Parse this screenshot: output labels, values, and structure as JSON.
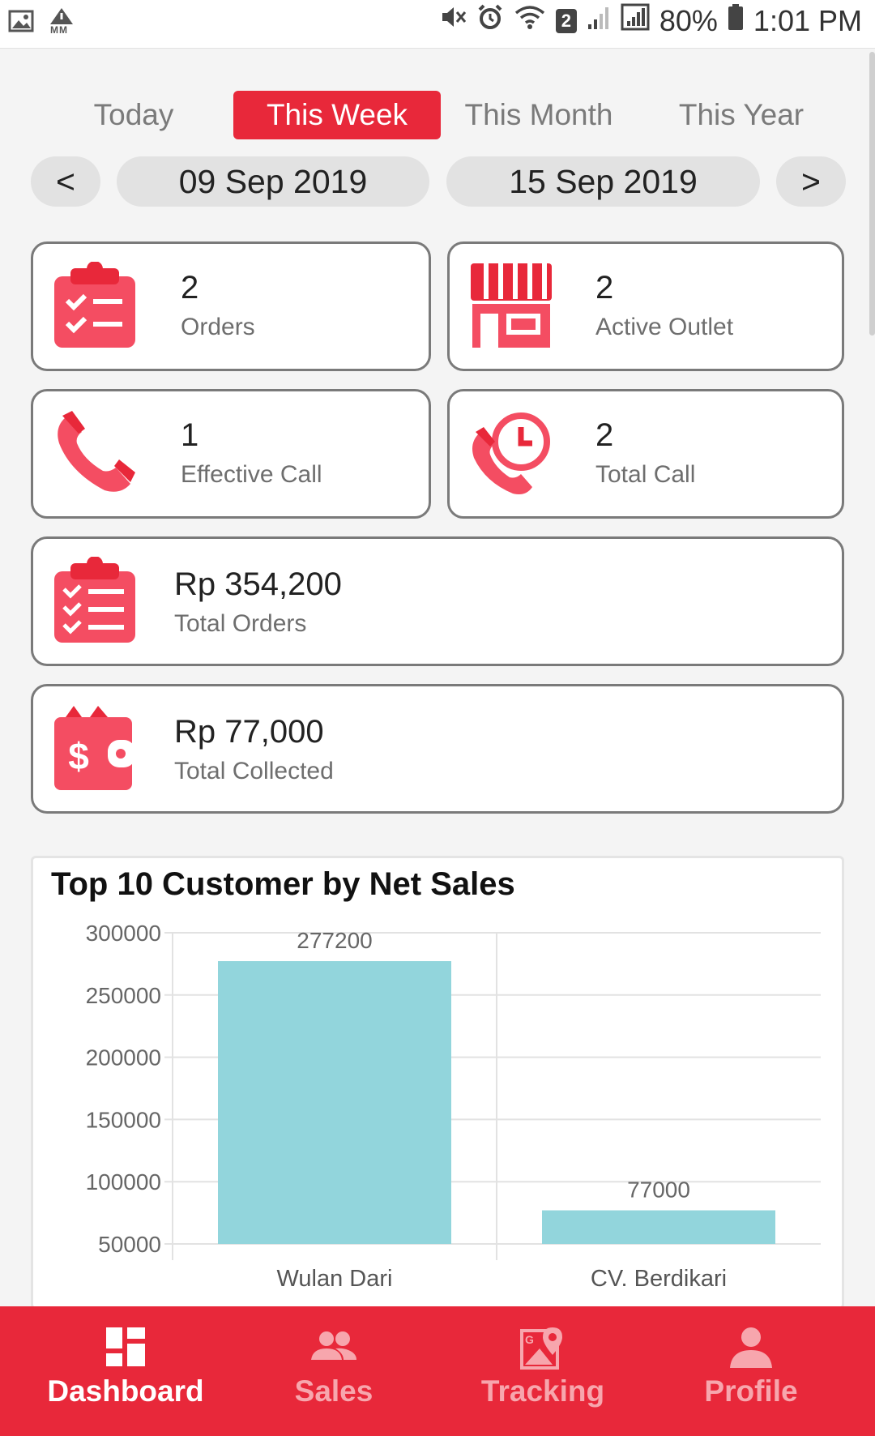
{
  "status_bar": {
    "battery": "80%",
    "time": "1:01 PM",
    "sim_badge": "2",
    "mm_label": "MM"
  },
  "period_tabs": [
    "Today",
    "This Week",
    "This Month",
    "This Year"
  ],
  "active_tab": "This Week",
  "date_range": {
    "prev": "<",
    "start": "09 Sep 2019",
    "end": "15 Sep 2019",
    "next": ">"
  },
  "stats": {
    "orders": {
      "value": "2",
      "label": "Orders",
      "icon": "clipboard-check-icon"
    },
    "active_outlet": {
      "value": "2",
      "label": "Active Outlet",
      "icon": "store-icon"
    },
    "effective_call": {
      "value": "1",
      "label": "Effective Call",
      "icon": "phone-icon"
    },
    "total_call": {
      "value": "2",
      "label": "Total Call",
      "icon": "phone-clock-icon"
    },
    "total_orders": {
      "value": "Rp 354,200",
      "label": "Total Orders",
      "icon": "clipboard-list-icon"
    },
    "total_collected": {
      "value": "Rp 77,000",
      "label": "Total Collected",
      "icon": "wallet-icon"
    }
  },
  "chart_data": {
    "type": "bar",
    "title": "Top 10 Customer by Net Sales",
    "categories": [
      "Wulan Dari",
      "CV. Berdikari"
    ],
    "values": [
      277200,
      77000
    ],
    "data_labels": [
      "277200",
      "77000"
    ],
    "y_ticks": [
      "300000",
      "250000",
      "200000",
      "150000",
      "100000",
      "50000"
    ],
    "ylim": [
      50000,
      300000
    ],
    "grid": true,
    "bar_color": "#92d5dc"
  },
  "bottom_nav": [
    {
      "label": "Dashboard",
      "icon": "dashboard-icon",
      "active": true
    },
    {
      "label": "Sales",
      "icon": "users-icon",
      "active": false
    },
    {
      "label": "Tracking",
      "icon": "map-pin-icon",
      "active": false
    },
    {
      "label": "Profile",
      "icon": "person-icon",
      "active": false
    }
  ],
  "colors": {
    "accent": "#e8283a",
    "icon": "#f44d62",
    "bar": "#92d5dc"
  }
}
